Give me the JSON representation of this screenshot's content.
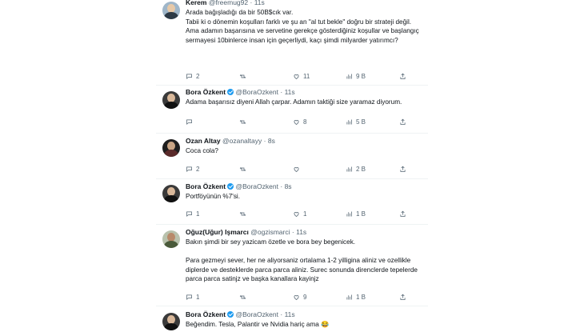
{
  "tweets": [
    {
      "name": "Kerem",
      "handle": "@freemug92",
      "time": "11s",
      "verified": false,
      "lines": [
        "Arada bağışladığı da bir 50B$cık var.",
        "Tabii ki o dönemin koşulları farklı ve şu an \"al tut bekle\" doğru bir strateji değil.",
        "Ama adamın başarısına ve servetine gerekçe gösterdiğiniz koşullar ve başlangıç sermayesi 10binlerce insan için geçerliydi, kaçı şimdi milyarder yatırımcı?"
      ],
      "stats": {
        "replies": "2",
        "retweets": "",
        "likes": "11",
        "views": "9 B"
      }
    },
    {
      "name": "Bora Özkent",
      "handle": "@BoraOzkent",
      "time": "11s",
      "verified": true,
      "lines": [
        "Adama başarısız diyeni Allah çarpar. Adamın taktiği size yaramaz diyorum."
      ],
      "stats": {
        "replies": "",
        "retweets": "",
        "likes": "8",
        "views": "5 B"
      }
    },
    {
      "name": "Ozan Altay",
      "handle": "@ozanaltayy",
      "time": "8s",
      "verified": false,
      "lines": [
        "Coca cola?"
      ],
      "stats": {
        "replies": "2",
        "retweets": "",
        "likes": "",
        "views": "2 B"
      }
    },
    {
      "name": "Bora Özkent",
      "handle": "@BoraOzkent",
      "time": "8s",
      "verified": true,
      "lines": [
        "Portföyünün %7'si."
      ],
      "stats": {
        "replies": "1",
        "retweets": "",
        "likes": "1",
        "views": "1 B"
      }
    },
    {
      "name": "Oğuz(Uğur) Işmarcı",
      "handle": "@ogzismarci",
      "time": "11s",
      "verified": false,
      "lines": [
        "Bakın şimdi bir sey yazicam özetle ve bora bey begenicek.",
        "",
        "Para gezmeyi sever, her ne aliyorsaniz ortalama 1-2 yilligina aliniz ve ozellikle diplerde ve desteklerde parca parca aliniz. Surec sonunda direnclerde tepelerde parca parca satinjz ve başka kanallara kayinjz"
      ],
      "stats": {
        "replies": "1",
        "retweets": "",
        "likes": "9",
        "views": "1 B"
      }
    },
    {
      "name": "Bora Özkent",
      "handle": "@BoraOzkent",
      "time": "11s",
      "verified": true,
      "lines": [
        "Beğendim. Tesla, Palantir ve Nvidia hariç ama 😂"
      ],
      "stats": {
        "replies": "",
        "retweets": "",
        "likes": "",
        "views": ""
      }
    }
  ],
  "separator": "·",
  "colors": {
    "text": "#0f1419",
    "muted": "#536471",
    "verified": "#1d9bf0",
    "divider": "#eff3f4"
  },
  "icons": {
    "reply": "reply-icon",
    "retweet": "retweet-icon",
    "like": "heart-icon",
    "views": "views-icon",
    "share": "share-icon"
  }
}
